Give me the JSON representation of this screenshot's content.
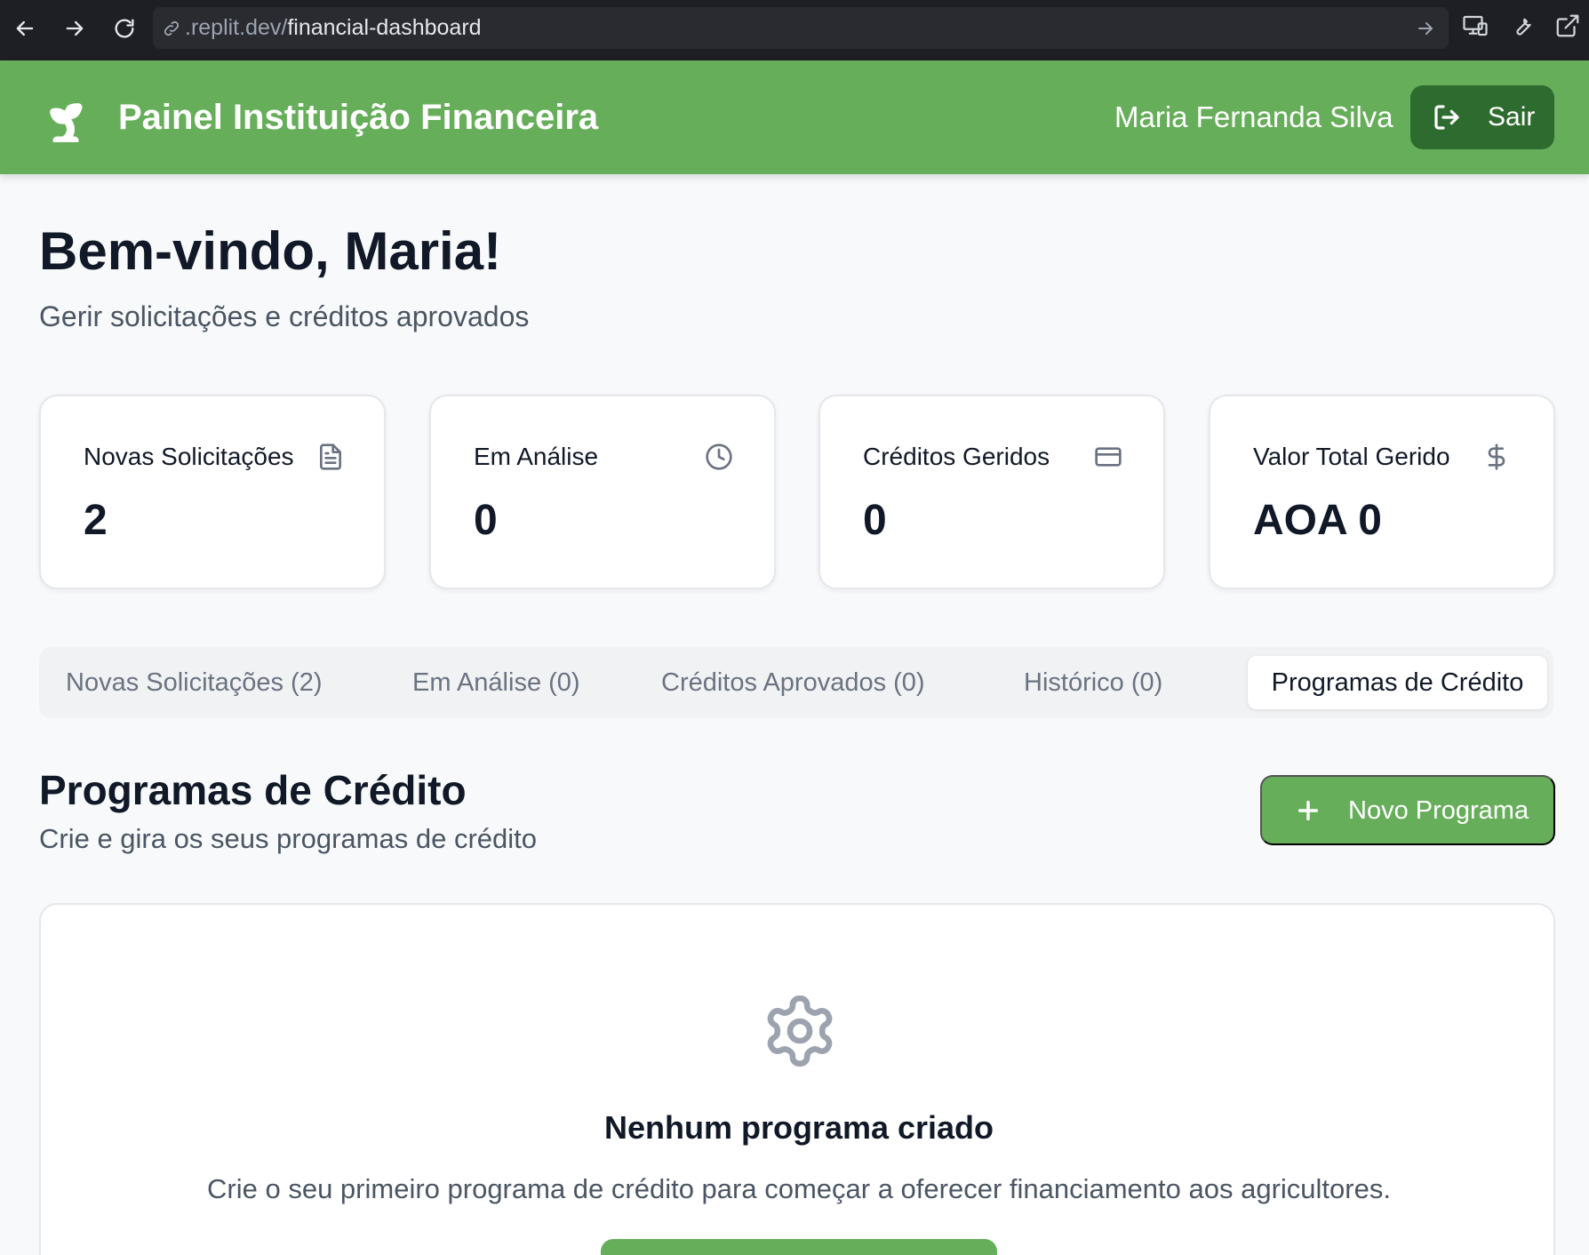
{
  "browser": {
    "url_prefix": ".replit.dev/",
    "url_path": "financial-dashboard",
    "icons": [
      "back-arrow-icon",
      "forward-arrow-icon",
      "reload-icon",
      "link-icon",
      "go-arrow-icon",
      "devices-icon",
      "wrench-icon",
      "external-link-icon"
    ]
  },
  "header": {
    "title": "Painel Instituição Financeira",
    "user_name": "Maria Fernanda Silva",
    "logout_label": "Sair",
    "logo_icon": "sprout-icon",
    "bg_color": "#67ae5b",
    "button_color": "#2e6b2f"
  },
  "welcome": {
    "title": "Bem-vindo, Maria!",
    "subtitle": "Gerir solicitações e créditos aprovados"
  },
  "stats": [
    {
      "label": "Novas Solicitações",
      "value": "2",
      "icon": "document-icon"
    },
    {
      "label": "Em Análise",
      "value": "0",
      "icon": "clock-icon"
    },
    {
      "label": "Créditos Geridos",
      "value": "0",
      "icon": "credit-card-icon"
    },
    {
      "label": "Valor Total Gerido",
      "value": "AOA 0",
      "icon": "dollar-icon"
    }
  ],
  "tabs": [
    {
      "label": "Novas Solicitações (2)",
      "active": false
    },
    {
      "label": "Em Análise (0)",
      "active": false
    },
    {
      "label": "Créditos Aprovados (0)",
      "active": false
    },
    {
      "label": "Histórico (0)",
      "active": false
    },
    {
      "label": "Programas de Crédito",
      "active": true
    }
  ],
  "programs": {
    "title": "Programas de Crédito",
    "subtitle": "Crie e gira os seus programas de crédito",
    "new_button_label": "Novo Programa",
    "empty_icon": "gear-icon",
    "empty_title": "Nenhum programa criado",
    "empty_description": "Crie o seu primeiro programa de crédito para começar a oferecer financiamento aos agricultores."
  }
}
